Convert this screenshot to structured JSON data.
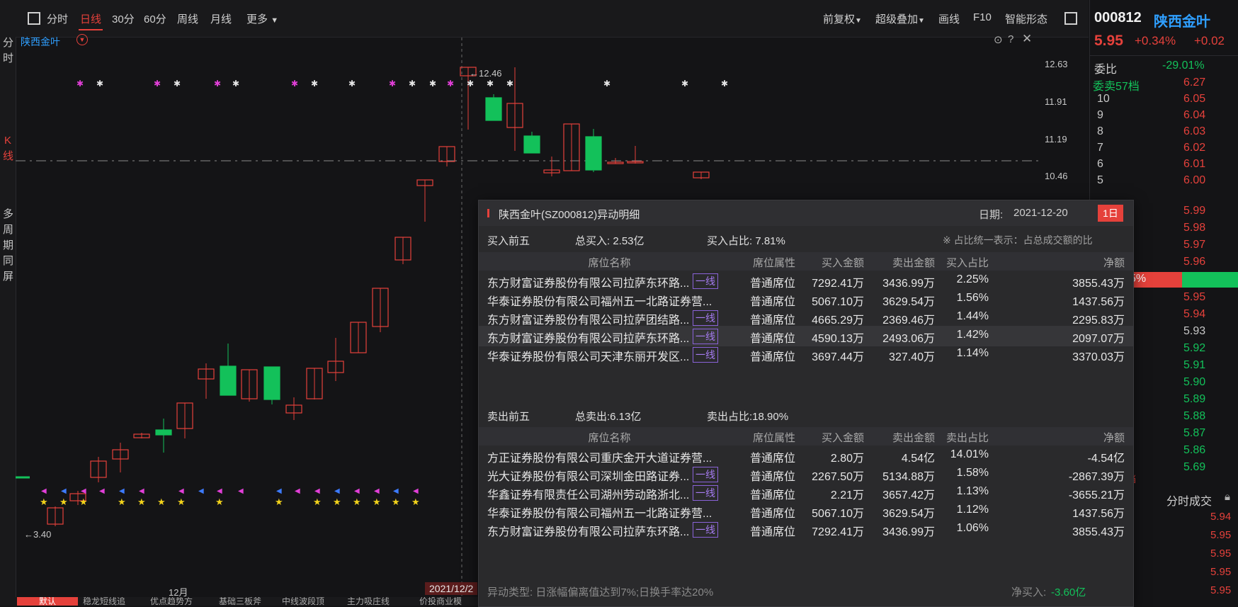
{
  "sidebar": {
    "fenshi": "分时",
    "kline": "K线",
    "multi": "多周期同屏"
  },
  "toolbar": {
    "periods": [
      "分时",
      "日线",
      "30分",
      "60分",
      "周线",
      "月线"
    ],
    "active": "日线",
    "more": "更多",
    "right_items": [
      "前复权",
      "超级叠加",
      "画线",
      "F10",
      "智能形态"
    ]
  },
  "chart": {
    "stock_label": "陕西金叶",
    "high_label": "12.46",
    "low_label": "3.40",
    "y_ticks": [
      "12.63",
      "11.91",
      "11.19",
      "10.46"
    ],
    "month_label": "12月",
    "cursor_date": "2021/12/2",
    "bottom_tabs": [
      "默认",
      "稳龙短线追",
      "优点趋势方",
      "基础三板斧",
      "中线波段顶",
      "主力吸庄线",
      "价投商业模"
    ]
  },
  "quote": {
    "code": "000812",
    "name": "陕西金叶",
    "price": "5.95",
    "change_pct": "+0.34%",
    "change": "+0.02",
    "weibi_label": "委比",
    "weibi": "-29.01%",
    "weimai_label": "委卖57档",
    "weimai_price": "6.27",
    "asks": [
      {
        "level": "10",
        "price": "6.05"
      },
      {
        "level": "9",
        "price": "6.04"
      },
      {
        "level": "8",
        "price": "6.03"
      },
      {
        "level": "7",
        "price": "6.02"
      },
      {
        "level": "6",
        "price": "6.01"
      },
      {
        "level": "5",
        "price": "6.00"
      }
    ],
    "more_prices": [
      "5.99",
      "5.98",
      "5.97",
      "5.96"
    ],
    "bid_prices": [
      "5.95",
      "5.94",
      "5.93",
      "5.92",
      "5.91",
      "5.90",
      "5.89",
      "5.88",
      "5.87",
      "5.86",
      "5.69"
    ],
    "bar_pct": "5%",
    "tick_title": "分时成交",
    "ticks": [
      "5.94",
      "5.95",
      "5.95",
      "5.95",
      "5.95"
    ]
  },
  "popup": {
    "title": "陕西金叶(SZ000812)异动明细",
    "date_label": "日期:",
    "date": "2021-12-20",
    "period_tab": "1日",
    "buy_section": "买入前五",
    "total_buy": "总买入: 2.53亿",
    "buy_ratio": "买入占比: 7.81%",
    "note": "※ 占比统一表示：占总成交额的比",
    "buy_headers": [
      "席位名称",
      "席位属性",
      "买入金额",
      "卖出金额",
      "买入占比",
      "净额"
    ],
    "buy_rows": [
      {
        "name": "东方财富证券股份有限公司拉萨东环路...",
        "tag": "一线",
        "attr": "普通席位",
        "buy": "7292.41万",
        "sell": "3436.99万",
        "ratio": "2.25%",
        "net": "3855.43万"
      },
      {
        "name": "华泰证券股份有限公司福州五一北路证券营...",
        "tag": "",
        "attr": "普通席位",
        "buy": "5067.10万",
        "sell": "3629.54万",
        "ratio": "1.56%",
        "net": "1437.56万"
      },
      {
        "name": "东方财富证券股份有限公司拉萨团结路...",
        "tag": "一线",
        "attr": "普通席位",
        "buy": "4665.29万",
        "sell": "2369.46万",
        "ratio": "1.44%",
        "net": "2295.83万"
      },
      {
        "name": "东方财富证券股份有限公司拉萨东环路...",
        "tag": "一线",
        "attr": "普通席位",
        "buy": "4590.13万",
        "sell": "2493.06万",
        "ratio": "1.42%",
        "net": "2097.07万"
      },
      {
        "name": "华泰证券股份有限公司天津东丽开发区...",
        "tag": "一线",
        "attr": "普通席位",
        "buy": "3697.44万",
        "sell": "327.40万",
        "ratio": "1.14%",
        "net": "3370.03万"
      }
    ],
    "sell_section": "卖出前五",
    "total_sell": "总卖出:6.13亿",
    "sell_ratio": "卖出占比:18.90%",
    "sell_headers": [
      "席位名称",
      "席位属性",
      "买入金额",
      "卖出金额",
      "卖出占比",
      "净额"
    ],
    "sell_rows": [
      {
        "name": "方正证券股份有限公司重庆金开大道证券营...",
        "tag": "",
        "attr": "普通席位",
        "buy": "2.80万",
        "sell": "4.54亿",
        "ratio": "14.01%",
        "net": "-4.54亿"
      },
      {
        "name": "光大证券股份有限公司深圳金田路证券...",
        "tag": "一线",
        "attr": "普通席位",
        "buy": "2267.50万",
        "sell": "5134.88万",
        "ratio": "1.58%",
        "net": "-2867.39万"
      },
      {
        "name": "华鑫证券有限责任公司湖州劳动路浙北...",
        "tag": "一线",
        "attr": "普通席位",
        "buy": "2.21万",
        "sell": "3657.42万",
        "ratio": "1.13%",
        "net": "-3655.21万"
      },
      {
        "name": "华泰证券股份有限公司福州五一北路证券营...",
        "tag": "",
        "attr": "普通席位",
        "buy": "5067.10万",
        "sell": "3629.54万",
        "ratio": "1.12%",
        "net": "1437.56万"
      },
      {
        "name": "东方财富证券股份有限公司拉萨东环路...",
        "tag": "一线",
        "attr": "普通席位",
        "buy": "7292.41万",
        "sell": "3436.99万",
        "ratio": "1.06%",
        "net": "3855.43万"
      }
    ],
    "abnormal": "异动类型: 日涨幅偏离值达到7%;日换手率达20%",
    "net_buy_label": "净买入:",
    "net_buy": "-3.60亿"
  },
  "colors": {
    "up": "#e5413b",
    "down": "#13c15a",
    "accent": "#2f9fff"
  }
}
